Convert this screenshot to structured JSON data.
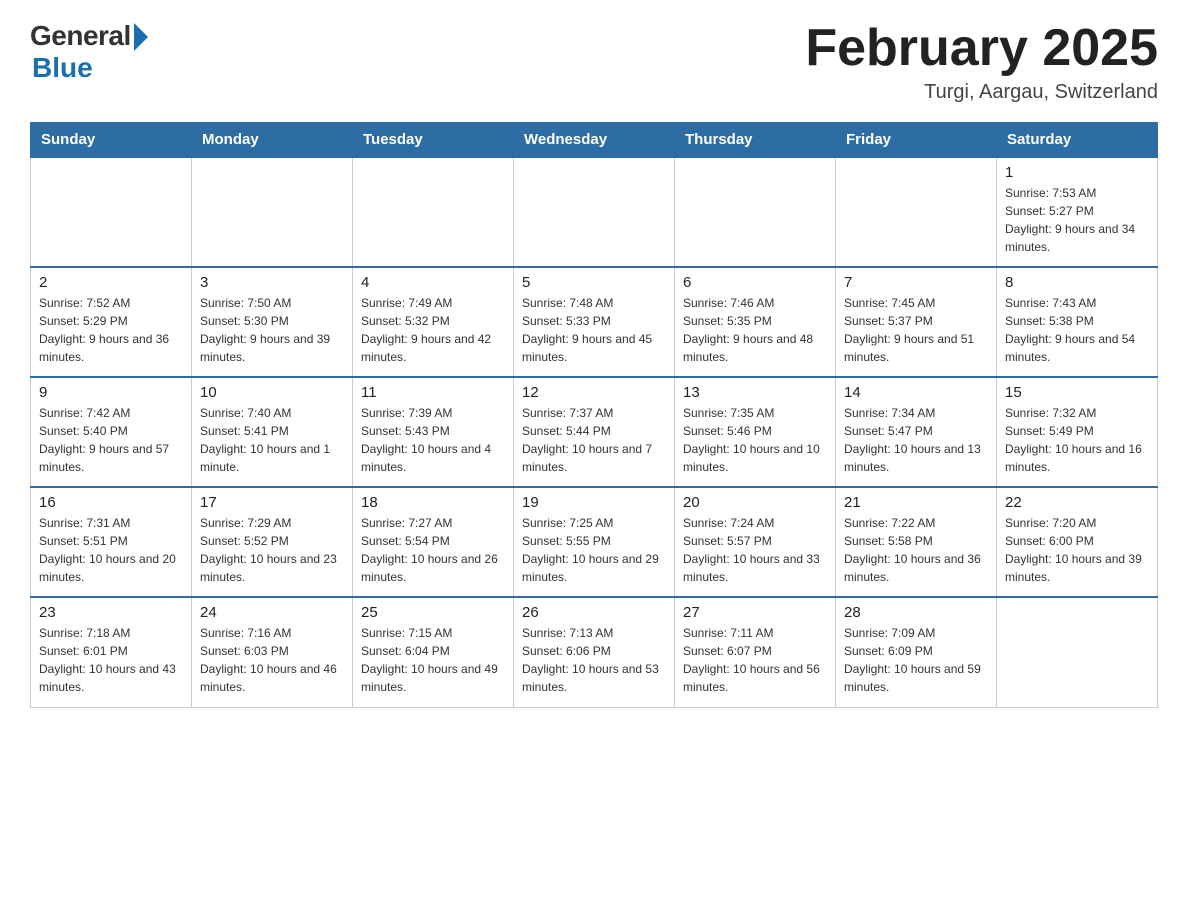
{
  "header": {
    "logo_general": "General",
    "logo_blue": "Blue",
    "month_title": "February 2025",
    "location": "Turgi, Aargau, Switzerland"
  },
  "days_of_week": [
    "Sunday",
    "Monday",
    "Tuesday",
    "Wednesday",
    "Thursday",
    "Friday",
    "Saturday"
  ],
  "weeks": [
    [
      {
        "day": "",
        "info": ""
      },
      {
        "day": "",
        "info": ""
      },
      {
        "day": "",
        "info": ""
      },
      {
        "day": "",
        "info": ""
      },
      {
        "day": "",
        "info": ""
      },
      {
        "day": "",
        "info": ""
      },
      {
        "day": "1",
        "info": "Sunrise: 7:53 AM\nSunset: 5:27 PM\nDaylight: 9 hours and 34 minutes."
      }
    ],
    [
      {
        "day": "2",
        "info": "Sunrise: 7:52 AM\nSunset: 5:29 PM\nDaylight: 9 hours and 36 minutes."
      },
      {
        "day": "3",
        "info": "Sunrise: 7:50 AM\nSunset: 5:30 PM\nDaylight: 9 hours and 39 minutes."
      },
      {
        "day": "4",
        "info": "Sunrise: 7:49 AM\nSunset: 5:32 PM\nDaylight: 9 hours and 42 minutes."
      },
      {
        "day": "5",
        "info": "Sunrise: 7:48 AM\nSunset: 5:33 PM\nDaylight: 9 hours and 45 minutes."
      },
      {
        "day": "6",
        "info": "Sunrise: 7:46 AM\nSunset: 5:35 PM\nDaylight: 9 hours and 48 minutes."
      },
      {
        "day": "7",
        "info": "Sunrise: 7:45 AM\nSunset: 5:37 PM\nDaylight: 9 hours and 51 minutes."
      },
      {
        "day": "8",
        "info": "Sunrise: 7:43 AM\nSunset: 5:38 PM\nDaylight: 9 hours and 54 minutes."
      }
    ],
    [
      {
        "day": "9",
        "info": "Sunrise: 7:42 AM\nSunset: 5:40 PM\nDaylight: 9 hours and 57 minutes."
      },
      {
        "day": "10",
        "info": "Sunrise: 7:40 AM\nSunset: 5:41 PM\nDaylight: 10 hours and 1 minute."
      },
      {
        "day": "11",
        "info": "Sunrise: 7:39 AM\nSunset: 5:43 PM\nDaylight: 10 hours and 4 minutes."
      },
      {
        "day": "12",
        "info": "Sunrise: 7:37 AM\nSunset: 5:44 PM\nDaylight: 10 hours and 7 minutes."
      },
      {
        "day": "13",
        "info": "Sunrise: 7:35 AM\nSunset: 5:46 PM\nDaylight: 10 hours and 10 minutes."
      },
      {
        "day": "14",
        "info": "Sunrise: 7:34 AM\nSunset: 5:47 PM\nDaylight: 10 hours and 13 minutes."
      },
      {
        "day": "15",
        "info": "Sunrise: 7:32 AM\nSunset: 5:49 PM\nDaylight: 10 hours and 16 minutes."
      }
    ],
    [
      {
        "day": "16",
        "info": "Sunrise: 7:31 AM\nSunset: 5:51 PM\nDaylight: 10 hours and 20 minutes."
      },
      {
        "day": "17",
        "info": "Sunrise: 7:29 AM\nSunset: 5:52 PM\nDaylight: 10 hours and 23 minutes."
      },
      {
        "day": "18",
        "info": "Sunrise: 7:27 AM\nSunset: 5:54 PM\nDaylight: 10 hours and 26 minutes."
      },
      {
        "day": "19",
        "info": "Sunrise: 7:25 AM\nSunset: 5:55 PM\nDaylight: 10 hours and 29 minutes."
      },
      {
        "day": "20",
        "info": "Sunrise: 7:24 AM\nSunset: 5:57 PM\nDaylight: 10 hours and 33 minutes."
      },
      {
        "day": "21",
        "info": "Sunrise: 7:22 AM\nSunset: 5:58 PM\nDaylight: 10 hours and 36 minutes."
      },
      {
        "day": "22",
        "info": "Sunrise: 7:20 AM\nSunset: 6:00 PM\nDaylight: 10 hours and 39 minutes."
      }
    ],
    [
      {
        "day": "23",
        "info": "Sunrise: 7:18 AM\nSunset: 6:01 PM\nDaylight: 10 hours and 43 minutes."
      },
      {
        "day": "24",
        "info": "Sunrise: 7:16 AM\nSunset: 6:03 PM\nDaylight: 10 hours and 46 minutes."
      },
      {
        "day": "25",
        "info": "Sunrise: 7:15 AM\nSunset: 6:04 PM\nDaylight: 10 hours and 49 minutes."
      },
      {
        "day": "26",
        "info": "Sunrise: 7:13 AM\nSunset: 6:06 PM\nDaylight: 10 hours and 53 minutes."
      },
      {
        "day": "27",
        "info": "Sunrise: 7:11 AM\nSunset: 6:07 PM\nDaylight: 10 hours and 56 minutes."
      },
      {
        "day": "28",
        "info": "Sunrise: 7:09 AM\nSunset: 6:09 PM\nDaylight: 10 hours and 59 minutes."
      },
      {
        "day": "",
        "info": ""
      }
    ]
  ]
}
